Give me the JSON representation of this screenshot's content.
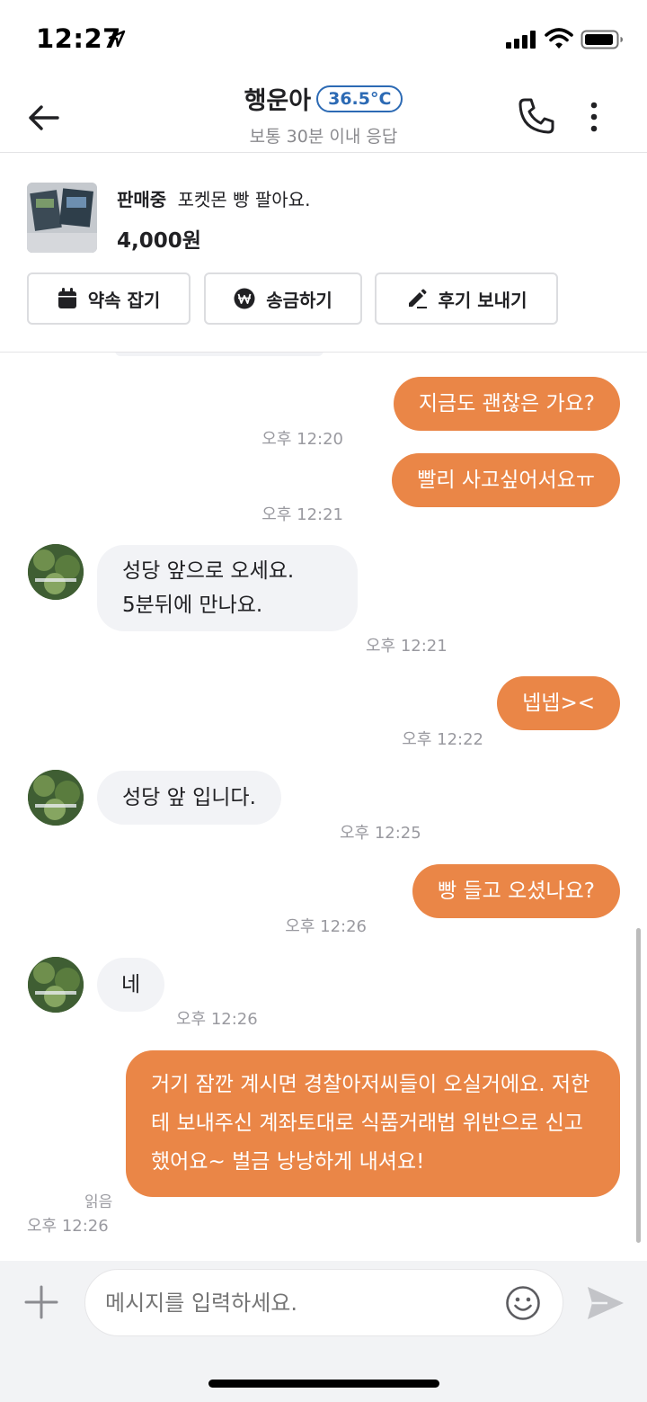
{
  "status_bar": {
    "time": "12:27"
  },
  "header": {
    "name": "행운아",
    "temperature": "36.5°C",
    "subtitle": "보통 30분 이내 응답"
  },
  "product": {
    "status": "판매중",
    "title": "포켓몬 빵 팔아요.",
    "price": "4,000원"
  },
  "actions": [
    {
      "label": "약속 잡기",
      "icon": "calendar-icon"
    },
    {
      "label": "송금하기",
      "icon": "won-coin-icon"
    },
    {
      "label": "후기 보내기",
      "icon": "pencil-icon"
    }
  ],
  "messages": [
    {
      "sender": "me",
      "text": "지금도 괜찮은 가요?",
      "time": "오후 12:20"
    },
    {
      "sender": "me",
      "text": "빨리 사고싶어서요ㅠ",
      "time": "오후 12:21"
    },
    {
      "sender": "other",
      "text": "성당 앞으로 오세요.\n5분뒤에  만나요.",
      "time": "오후 12:21"
    },
    {
      "sender": "me",
      "text": "넵넵><",
      "time": "오후 12:22"
    },
    {
      "sender": "other",
      "text": "성당  앞   입니다.",
      "time": "오후 12:25"
    },
    {
      "sender": "me",
      "text": "빵 들고 오셨나요?",
      "time": "오후 12:26"
    },
    {
      "sender": "other",
      "text": "네",
      "time": "오후 12:26"
    },
    {
      "sender": "me",
      "text": "거기 잠깐 계시면 경찰아저씨들이 오실거에요. 저한테 보내주신 계좌토대로 식품거래법 위반으로 신고 했어요~ 벌금 낭낭하게 내셔요!",
      "time": "오후 12:26",
      "read_label": "읽음"
    }
  ],
  "input": {
    "placeholder": "메시지를 입력하세요."
  },
  "colors": {
    "accent": "#ea8647",
    "temperature": "#2c6ab4",
    "incoming_bubble": "#f2f3f6"
  }
}
